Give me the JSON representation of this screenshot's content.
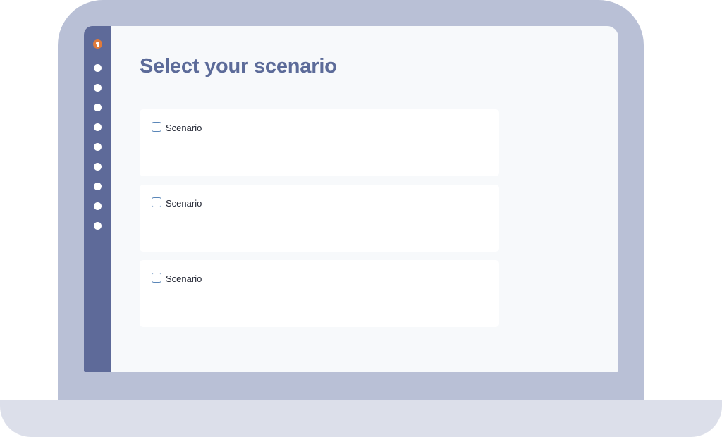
{
  "header": {
    "title": "Select your scenario"
  },
  "sidebar": {
    "logo_icon": "keyhole-logo-icon",
    "nav_items": [
      "nav-dot",
      "nav-dot",
      "nav-dot",
      "nav-dot",
      "nav-dot",
      "nav-dot",
      "nav-dot",
      "nav-dot",
      "nav-dot"
    ]
  },
  "scenarios": [
    {
      "label": "Scenario",
      "checked": false
    },
    {
      "label": "Scenario",
      "checked": false
    },
    {
      "label": "Scenario",
      "checked": false
    }
  ],
  "colors": {
    "device_frame": "#b9c0d6",
    "device_base": "#dcdfea",
    "sidebar": "#5e6a99",
    "logo_accent": "#e07a3a",
    "title": "#5c6b99",
    "checkbox_border": "#5a86b8"
  }
}
